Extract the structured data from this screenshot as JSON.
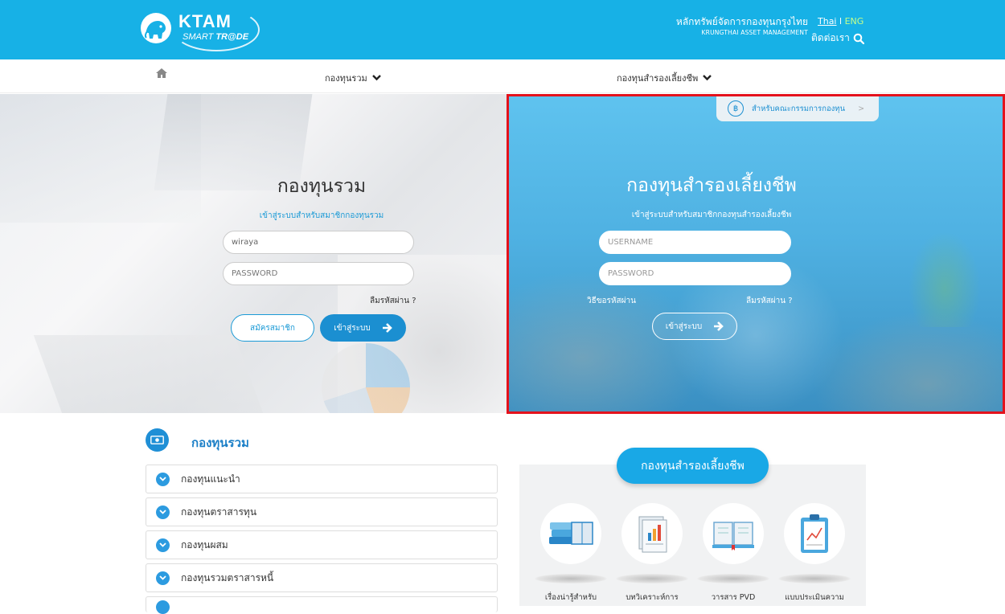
{
  "header": {
    "logo_title": "KTAM",
    "logo_sub_plain": "SMART ",
    "logo_sub_bold": "TR@DE",
    "org_name_th": "หลักทรัพย์จัดการกองทุนกรุงไทย",
    "org_name_en": "KRUNGTHAI ASSET MANAGEMENT",
    "lang_thai": "Thai",
    "lang_sep": " l ",
    "lang_eng": "ENG",
    "contact_label": "ติดต่อเรา",
    "accent_color": "#17b1e6"
  },
  "nav": {
    "home_icon": "home-icon",
    "mutual_fund_label": "กองทุนรวม",
    "provident_fund_label": "กองทุนสำรองเลี้ยงชีพ"
  },
  "mutual_login": {
    "title": "กองทุนรวม",
    "subtitle": "เข้าสู่ระบบสำหรับสมาชิกกองทุนรวม",
    "username_value": "wiraya",
    "password_placeholder": "PASSWORD",
    "forgot_password": "ลืมรหัสผ่าน ?",
    "register_label": "สมัครสมาชิก",
    "login_label": "เข้าสู่ระบบ"
  },
  "provident_login": {
    "committee_label": "สำหรับคณะกรรมการกองทุน",
    "title": "กองทุนสำรองเลี้ยงชีพ",
    "subtitle": "เข้าสู่ระบบสำหรับสมาชิกกองทุนสำรองเลี้ยงชีพ",
    "username_placeholder": "USERNAME",
    "password_placeholder": "PASSWORD",
    "how_to_request": "วิธีขอรหัสผ่าน",
    "forgot_password": "ลืมรหัสผ่าน ?",
    "login_label": "เข้าสู่ระบบ"
  },
  "mutual_section": {
    "title": "กองทุนรวม",
    "items": [
      {
        "label": "กองทุนแนะนำ"
      },
      {
        "label": "กองทุนตราสารทุน"
      },
      {
        "label": "กองทุนผสม"
      },
      {
        "label": "กองทุนรวมตราสารหนี้"
      }
    ]
  },
  "provident_section": {
    "title": "กองทุนสำรองเลี้ยงชีพ",
    "items": [
      {
        "label": "เรื่องน่ารู้สำหรับ",
        "icon": "books-icon"
      },
      {
        "label": "บทวิเคราะห์การ",
        "icon": "report-icon"
      },
      {
        "label": "วารสาร PVD",
        "icon": "open-book-icon"
      },
      {
        "label": "แบบประเมินความ",
        "icon": "clipboard-icon"
      }
    ]
  }
}
